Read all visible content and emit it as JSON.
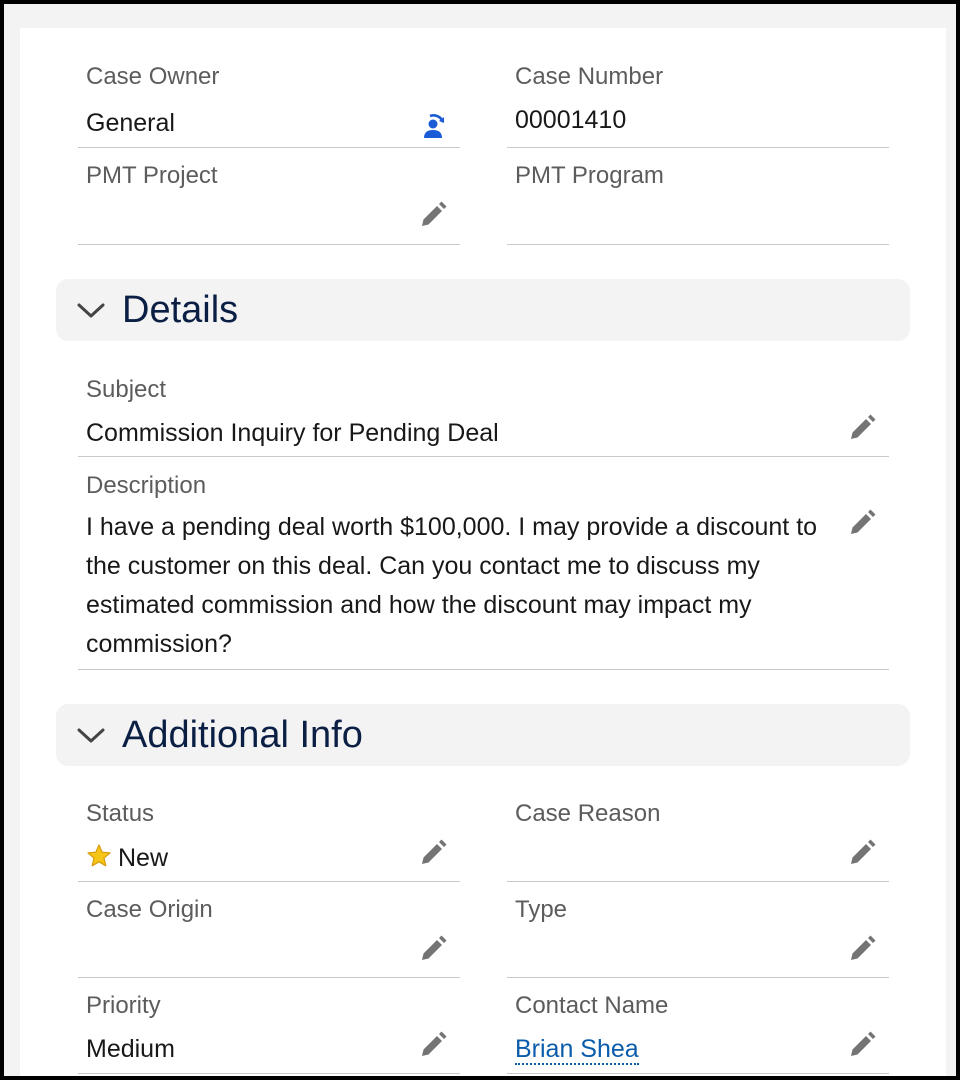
{
  "top": {
    "case_owner_label": "Case Owner",
    "case_owner_value": "General",
    "case_number_label": "Case Number",
    "case_number_value": "00001410",
    "pmt_project_label": "PMT Project",
    "pmt_program_label": "PMT Program"
  },
  "details": {
    "title": "Details",
    "subject_label": "Subject",
    "subject_value": "Commission Inquiry for Pending Deal",
    "description_label": "Description",
    "description_value": "I have a pending deal worth $100,000. I may provide a discount to the customer on this deal. Can you contact me to discuss my estimated commission and how the discount may impact my commission?"
  },
  "additional": {
    "title": "Additional Info",
    "status_label": "Status",
    "status_value": "New",
    "case_reason_label": "Case Reason",
    "case_origin_label": "Case Origin",
    "type_label": "Type",
    "priority_label": "Priority",
    "priority_value": "Medium",
    "contact_name_label": "Contact Name",
    "contact_name_value": "Brian Shea"
  },
  "icons": {
    "edit": "pencil-icon",
    "change_owner": "change-owner-icon",
    "collapse": "chevron-down-icon",
    "status_marker": "star-icon"
  },
  "colors": {
    "section_title": "#0b1f44",
    "link": "#0b5cab",
    "owner_icon": "#1b5bd6",
    "star": "#f5c518"
  }
}
